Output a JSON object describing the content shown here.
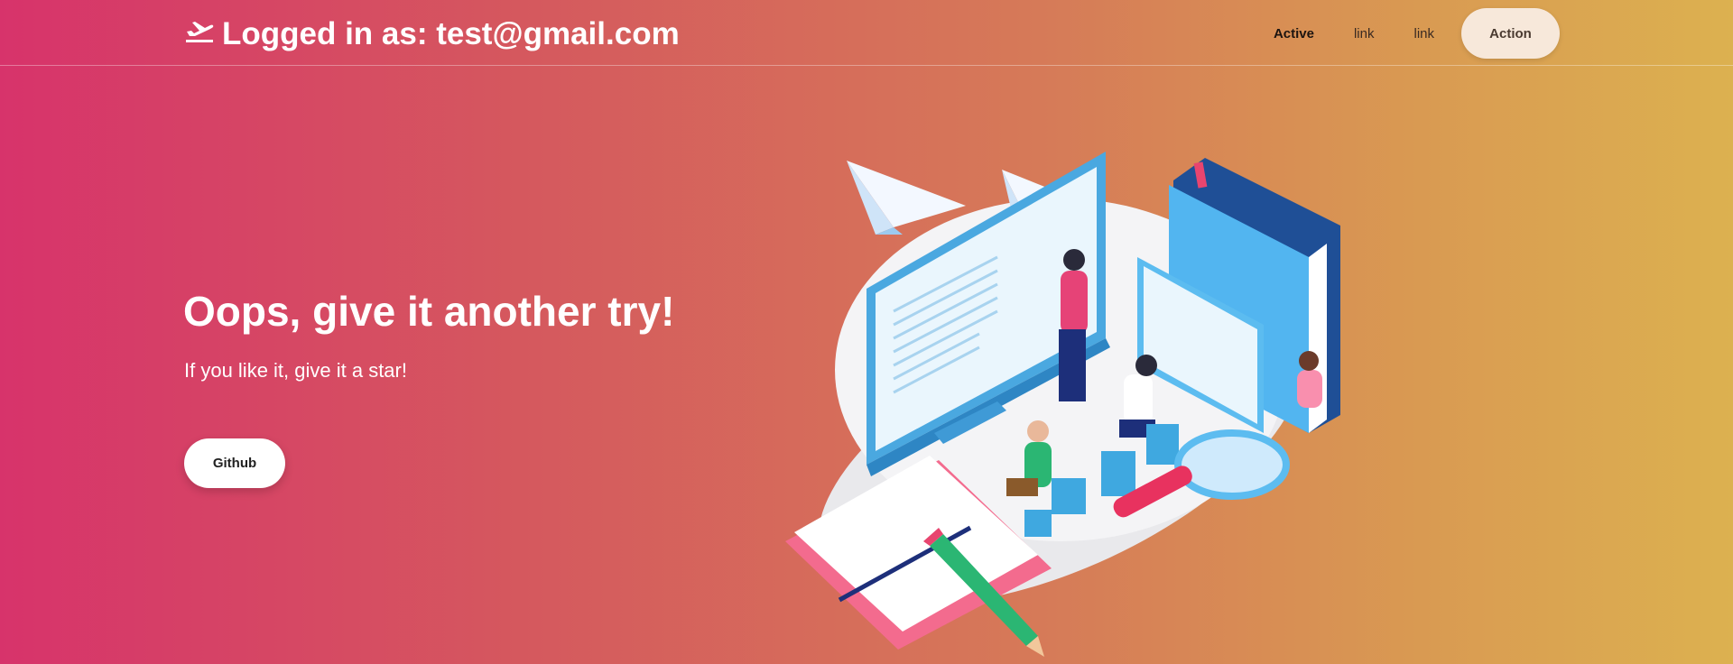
{
  "navbar": {
    "brand_text": "Logged in as: test@gmail.com",
    "brand_icon": "airplane-departure-icon",
    "links": [
      {
        "label": "Active",
        "active": true
      },
      {
        "label": "link",
        "active": false
      },
      {
        "label": "link",
        "active": false
      }
    ],
    "action_label": "Action"
  },
  "hero": {
    "title": "Oops, give it another try!",
    "subtitle": "If you like it, give it a star!",
    "button_label": "Github"
  },
  "colors": {
    "gradient_start": "#d7336b",
    "gradient_end": "#dcb150",
    "action_bg": "#f7e8da",
    "white": "#ffffff"
  }
}
